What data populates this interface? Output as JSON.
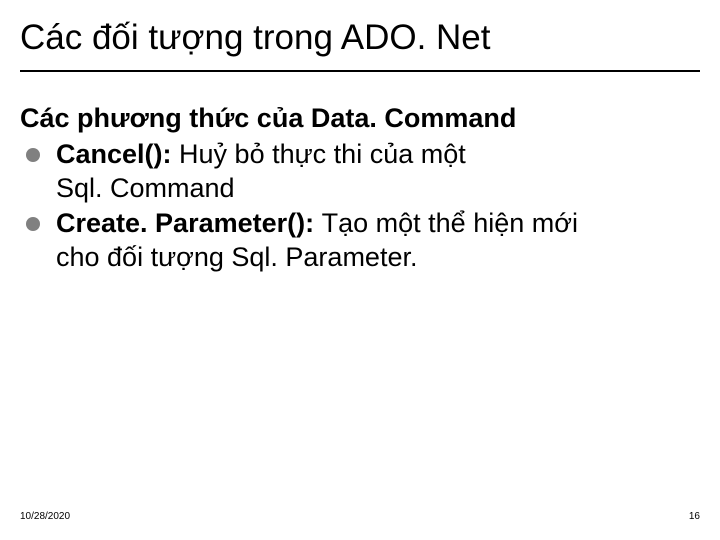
{
  "title": "Các đối tượng trong ADO. Net",
  "subtitle": "Các phương thức của Data. Command",
  "items": [
    {
      "method": "Cancel(): ",
      "desc_a": "Huỷ bỏ thực thi của một",
      "desc_b": "Sql. Command"
    },
    {
      "method": "Create. Parameter(): ",
      "desc_a": "Tạo một thể hiện mới",
      "desc_b": "cho đối tượng Sql. Parameter."
    }
  ],
  "footer": {
    "date": "10/28/2020",
    "page": "16"
  }
}
